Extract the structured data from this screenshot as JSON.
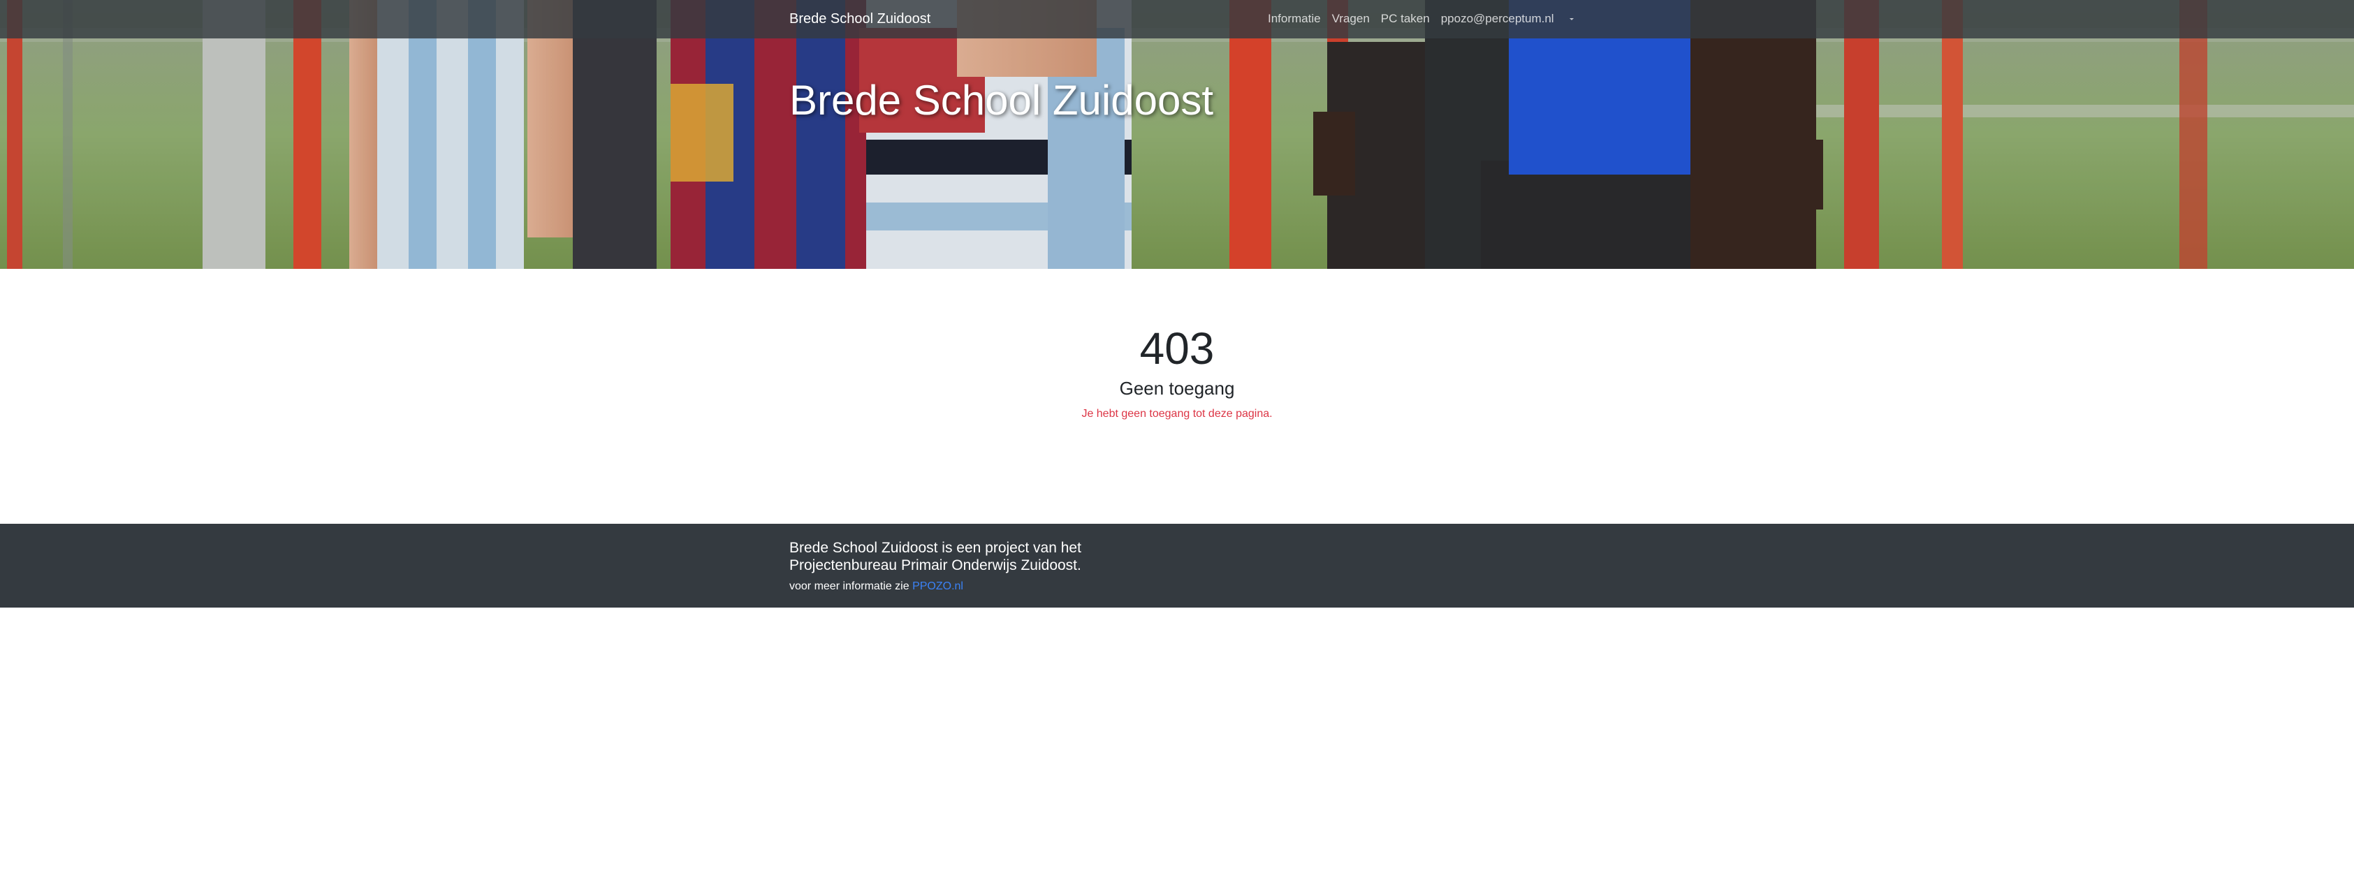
{
  "navbar": {
    "brand": "Brede School Zuidoost",
    "items": [
      {
        "label": "Informatie"
      },
      {
        "label": "Vragen"
      },
      {
        "label": "PC taken"
      },
      {
        "label": "ppozo@perceptum.nl"
      }
    ],
    "dropdown_icon": "caret-down-icon"
  },
  "hero": {
    "title": "Brede School Zuidoost"
  },
  "error": {
    "code": "403",
    "title": "Geen toegang",
    "message": "Je hebt geen toegang tot deze pagina."
  },
  "footer": {
    "text": "Brede School Zuidoost is een project van het Projectenbureau Primair Onderwijs Zuidoost.",
    "more_info_prefix": "voor meer informatie zie",
    "link_label": "PPOZO.nl"
  },
  "colors": {
    "navbar_bg": "#343a40",
    "footer_bg": "#343a40",
    "error_text": "#dc3545",
    "link": "#3b82f6"
  }
}
